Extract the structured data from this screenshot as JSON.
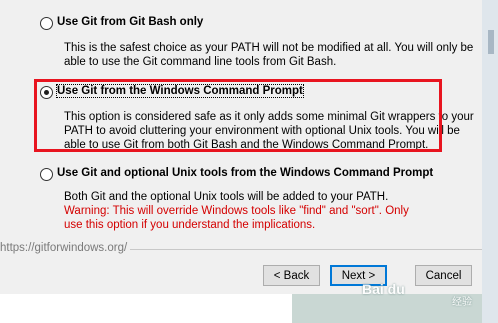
{
  "options": [
    {
      "label": "Use Git from Git Bash only",
      "checked": false,
      "desc": [
        "This is the safest choice as your PATH will not be modified at all. You will only be",
        "able to use the Git command line tools from Git Bash."
      ]
    },
    {
      "label": "Use Git from the Windows Command Prompt",
      "checked": true,
      "desc": [
        "This option is considered safe as it only adds some minimal Git wrappers to your",
        "PATH to avoid cluttering your environment with optional Unix tools. You will be",
        "able to use Git from both Git Bash and the Windows Command Prompt."
      ]
    },
    {
      "label": "Use Git and optional Unix tools from the Windows Command Prompt",
      "checked": false,
      "desc": [
        "Both Git and the optional Unix tools will be added to your PATH."
      ],
      "warning": [
        "Warning: This will override Windows tools like \"find\" and \"sort\". Only",
        "use this option if you understand the implications."
      ]
    }
  ],
  "footer": {
    "url": "https://gitforwindows.org/",
    "back_label": "< Back",
    "next_label": "Next >",
    "cancel_label": "Cancel"
  },
  "watermark": {
    "brand": "Bai du",
    "sub": "经验"
  },
  "colors": {
    "highlight": "#e8141f",
    "warning": "#d40000",
    "default_button": "#0078d7"
  }
}
